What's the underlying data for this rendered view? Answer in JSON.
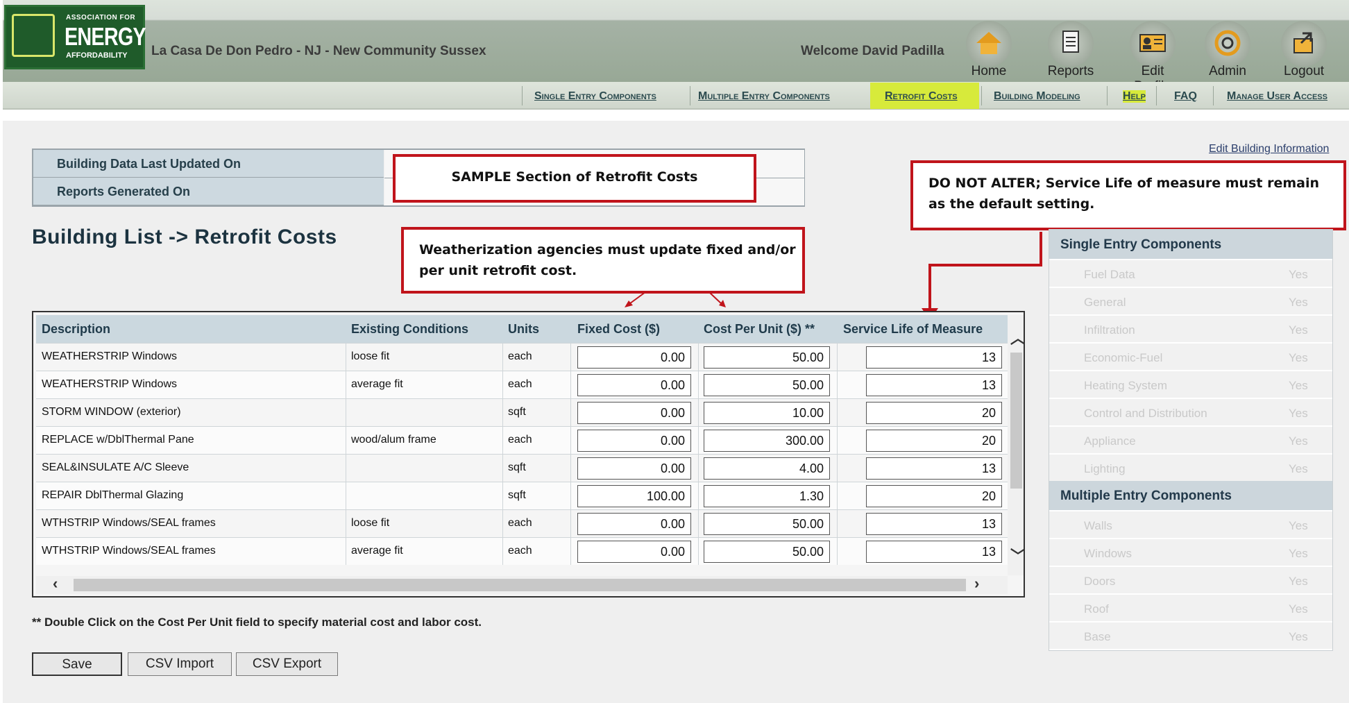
{
  "brand": {
    "line1": "ASSOCIATION FOR",
    "line2": "ENERGY",
    "line3": "AFFORDABILITY"
  },
  "header": {
    "site": "La Casa De Don Pedro - NJ - New Community Sussex",
    "welcome": "Welcome David Padilla"
  },
  "topnav": [
    "Home",
    "Reports",
    "Edit Profile",
    "Admin",
    "Logout"
  ],
  "subnav": [
    "Single Entry Components",
    "Multiple Entry Components",
    "Retrofit Costs",
    "Building Modeling",
    "Help",
    "FAQ",
    "Manage User Access"
  ],
  "info": {
    "updated_label": "Building Data Last Updated On",
    "reports_label": "Reports Generated On"
  },
  "edit_link": "Edit Building Information",
  "page_title": "Building List -> Retrofit Costs",
  "callouts": {
    "sample": "SAMPLE Section of Retrofit Costs",
    "agencies": "Weatherization agencies must update fixed and/or per unit retrofit cost.",
    "donotalter": "DO NOT ALTER; Service Life of measure must remain as the default setting."
  },
  "grid": {
    "headers": [
      "Description",
      "Existing Conditions",
      "Units",
      "Fixed Cost ($)",
      "Cost Per Unit ($) **",
      "Service Life of Measure"
    ],
    "rows": [
      {
        "desc": "WEATHERSTRIP Windows",
        "cond": "loose fit",
        "units": "each",
        "fixed": "0.00",
        "cpu": "50.00",
        "life": "13"
      },
      {
        "desc": "WEATHERSTRIP Windows",
        "cond": "average fit",
        "units": "each",
        "fixed": "0.00",
        "cpu": "50.00",
        "life": "13"
      },
      {
        "desc": "STORM WINDOW (exterior)",
        "cond": "",
        "units": "sqft",
        "fixed": "0.00",
        "cpu": "10.00",
        "life": "20"
      },
      {
        "desc": "REPLACE w/DblThermal Pane",
        "cond": "wood/alum frame",
        "units": "each",
        "fixed": "0.00",
        "cpu": "300.00",
        "life": "20"
      },
      {
        "desc": "SEAL&INSULATE A/C Sleeve",
        "cond": "",
        "units": "sqft",
        "fixed": "0.00",
        "cpu": "4.00",
        "life": "13"
      },
      {
        "desc": "REPAIR DblThermal Glazing",
        "cond": "",
        "units": "sqft",
        "fixed": "100.00",
        "cpu": "1.30",
        "life": "20"
      },
      {
        "desc": "WTHSTRIP Windows/SEAL frames",
        "cond": "loose fit",
        "units": "each",
        "fixed": "0.00",
        "cpu": "50.00",
        "life": "13"
      },
      {
        "desc": "WTHSTRIP Windows/SEAL frames",
        "cond": "average fit",
        "units": "each",
        "fixed": "0.00",
        "cpu": "50.00",
        "life": "13"
      }
    ]
  },
  "note": "** Double Click on the Cost Per Unit field to specify material cost and labor cost.",
  "buttons": {
    "save": "Save",
    "csv_import": "CSV Import",
    "csv_export": "CSV Export"
  },
  "side": {
    "single_title": "Single Entry Components",
    "single": [
      {
        "n": "Fuel Data",
        "y": "Yes"
      },
      {
        "n": "General",
        "y": "Yes"
      },
      {
        "n": "Infiltration",
        "y": "Yes"
      },
      {
        "n": "Economic-Fuel",
        "y": "Yes"
      },
      {
        "n": "Heating System",
        "y": "Yes"
      },
      {
        "n": "Control and Distribution",
        "y": "Yes"
      },
      {
        "n": "Appliance",
        "y": "Yes"
      },
      {
        "n": "Lighting",
        "y": "Yes"
      }
    ],
    "multi_title": "Multiple Entry Components",
    "multi": [
      {
        "n": "Walls",
        "y": "Yes"
      },
      {
        "n": "Windows",
        "y": "Yes"
      },
      {
        "n": "Doors",
        "y": "Yes"
      },
      {
        "n": "Roof",
        "y": "Yes"
      },
      {
        "n": "Base",
        "y": "Yes"
      }
    ]
  },
  "colors": {
    "callout_border": "#c0141b",
    "active_tab": "#d7ea3b",
    "logo_bg": "#1f5b2a"
  }
}
